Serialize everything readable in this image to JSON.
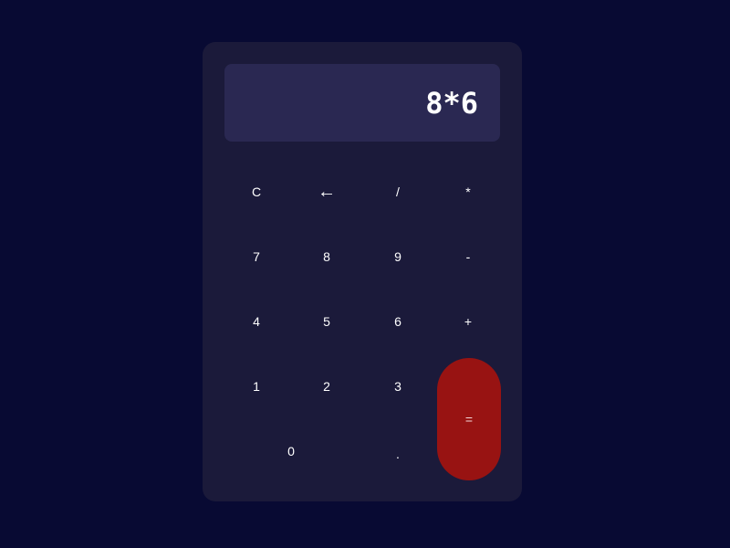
{
  "display": {
    "expression": "8*6"
  },
  "keys": {
    "clear": "C",
    "backspace": "←",
    "divide": "/",
    "multiply": "*",
    "seven": "7",
    "eight": "8",
    "nine": "9",
    "subtract": "-",
    "four": "4",
    "five": "5",
    "six": "6",
    "add": "+",
    "one": "1",
    "two": "2",
    "three": "3",
    "equals": "=",
    "zero": "0",
    "decimal": "."
  },
  "colors": {
    "page_background": "#080a33",
    "panel": "#1b1a3a",
    "display_background": "#2a2852",
    "equals_accent": "#981312"
  }
}
